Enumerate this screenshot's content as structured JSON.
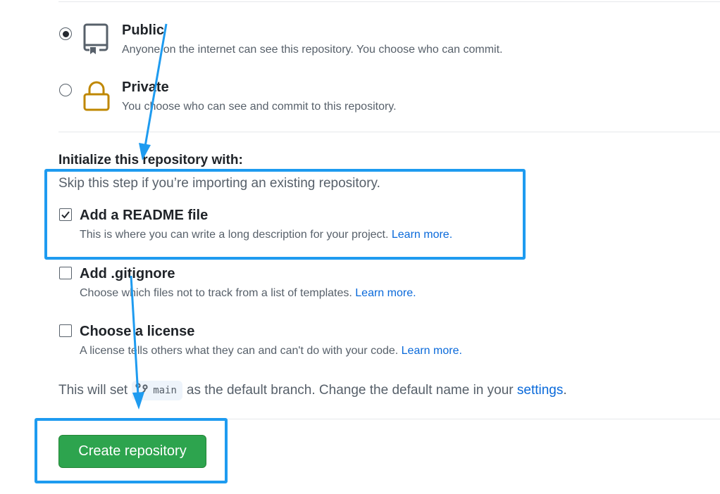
{
  "visibility": {
    "public": {
      "title": "Public",
      "description": "Anyone on the internet can see this repository. You choose who can commit.",
      "selected": true,
      "icon": "repo-icon"
    },
    "private": {
      "title": "Private",
      "description": "You choose who can see and commit to this repository.",
      "selected": false,
      "icon": "lock-icon"
    }
  },
  "initialize": {
    "title": "Initialize this repository with:",
    "subtitle": "Skip this step if you’re importing an existing repository.",
    "options": [
      {
        "label": "Add a README file",
        "description": "This is where you can write a long description for your project.",
        "link": "Learn more.",
        "checked": true
      },
      {
        "label": "Add .gitignore",
        "description": "Choose which files not to track from a list of templates.",
        "link": "Learn more.",
        "checked": false
      },
      {
        "label": "Choose a license",
        "description": "A license tells others what they can and can't do with your code.",
        "link": "Learn more.",
        "checked": false
      }
    ]
  },
  "branch_note": {
    "prefix": "This will set",
    "branch": "main",
    "middle": "as the default branch. Change the default name in your",
    "link": "settings",
    "suffix": "."
  },
  "create_button": {
    "label": "Create repository"
  },
  "colors": {
    "primary_button": "#2da44e",
    "link": "#0969da",
    "annotation": "#1e9bf0",
    "lock_icon": "#bf8700"
  }
}
